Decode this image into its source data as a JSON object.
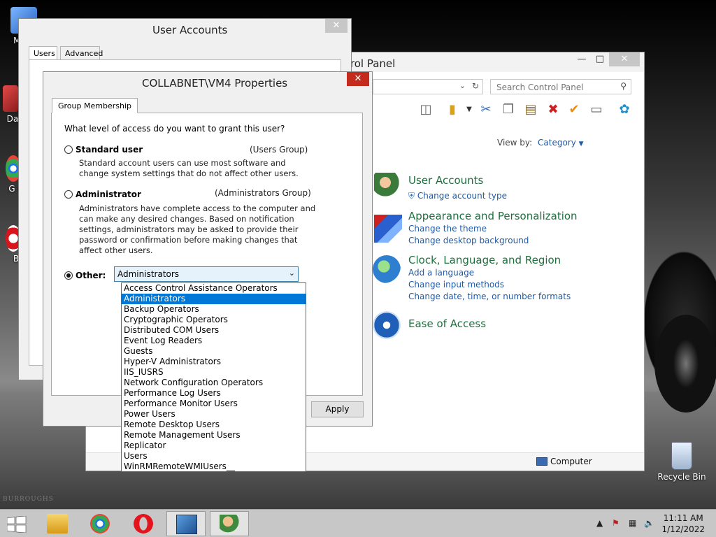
{
  "desktop": {
    "icons": [
      {
        "label": "My C"
      },
      {
        "label": "Data"
      },
      {
        "label": "G C"
      },
      {
        "label": "B"
      }
    ],
    "recycle_bin": "Recycle Bin",
    "watermark": "BURROUGHS"
  },
  "control_panel": {
    "title": "trol Panel",
    "search_placeholder": "Search Control Panel",
    "view_by_label": "View by:",
    "view_by_value": "Category",
    "categories": [
      {
        "title": "User Accounts",
        "links": [
          "Change account type"
        ]
      },
      {
        "title": "Appearance and Personalization",
        "links": [
          "Change the theme",
          "Change desktop background"
        ]
      },
      {
        "title": "Clock, Language, and Region",
        "links": [
          "Add a language",
          "Change input methods",
          "Change date, time, or number formats"
        ]
      },
      {
        "title": "Ease of Access",
        "links": []
      }
    ],
    "status": "Computer"
  },
  "user_accounts": {
    "title": "User Accounts",
    "tabs": [
      "Users",
      "Advanced"
    ]
  },
  "properties": {
    "title": "COLLABNET\\VM4 Properties",
    "tab": "Group Membership",
    "question": "What level of access do you want to grant this user?",
    "standard": {
      "label": "Standard user",
      "group": "(Users Group)",
      "desc": "Standard account users can use most software and change system settings that do not affect other users."
    },
    "administrator": {
      "label": "Administrator",
      "group": "(Administrators Group)",
      "desc": "Administrators have complete access to the computer and can make any desired changes. Based on notification settings, administrators may be asked to provide their password or confirmation before making changes that affect other users."
    },
    "other": {
      "label": "Other:",
      "selected": "Administrators"
    },
    "apply": "Apply",
    "dropdown_options": [
      "Access Control Assistance Operators",
      "Administrators",
      "Backup Operators",
      "Cryptographic Operators",
      "Distributed COM Users",
      "Event Log Readers",
      "Guests",
      "Hyper-V Administrators",
      "IIS_IUSRS",
      "Network Configuration Operators",
      "Performance Log Users",
      "Performance Monitor Users",
      "Power Users",
      "Remote Desktop Users",
      "Remote Management Users",
      "Replicator",
      "Users",
      "WinRMRemoteWMIUsers__"
    ]
  },
  "taskbar": {
    "time": "11:11 AM",
    "date": "1/12/2022"
  },
  "colors": {
    "accent": "#0078d7",
    "link": "#1e5aa8",
    "category": "#1e6f3e",
    "close_red": "#c42b1c"
  }
}
